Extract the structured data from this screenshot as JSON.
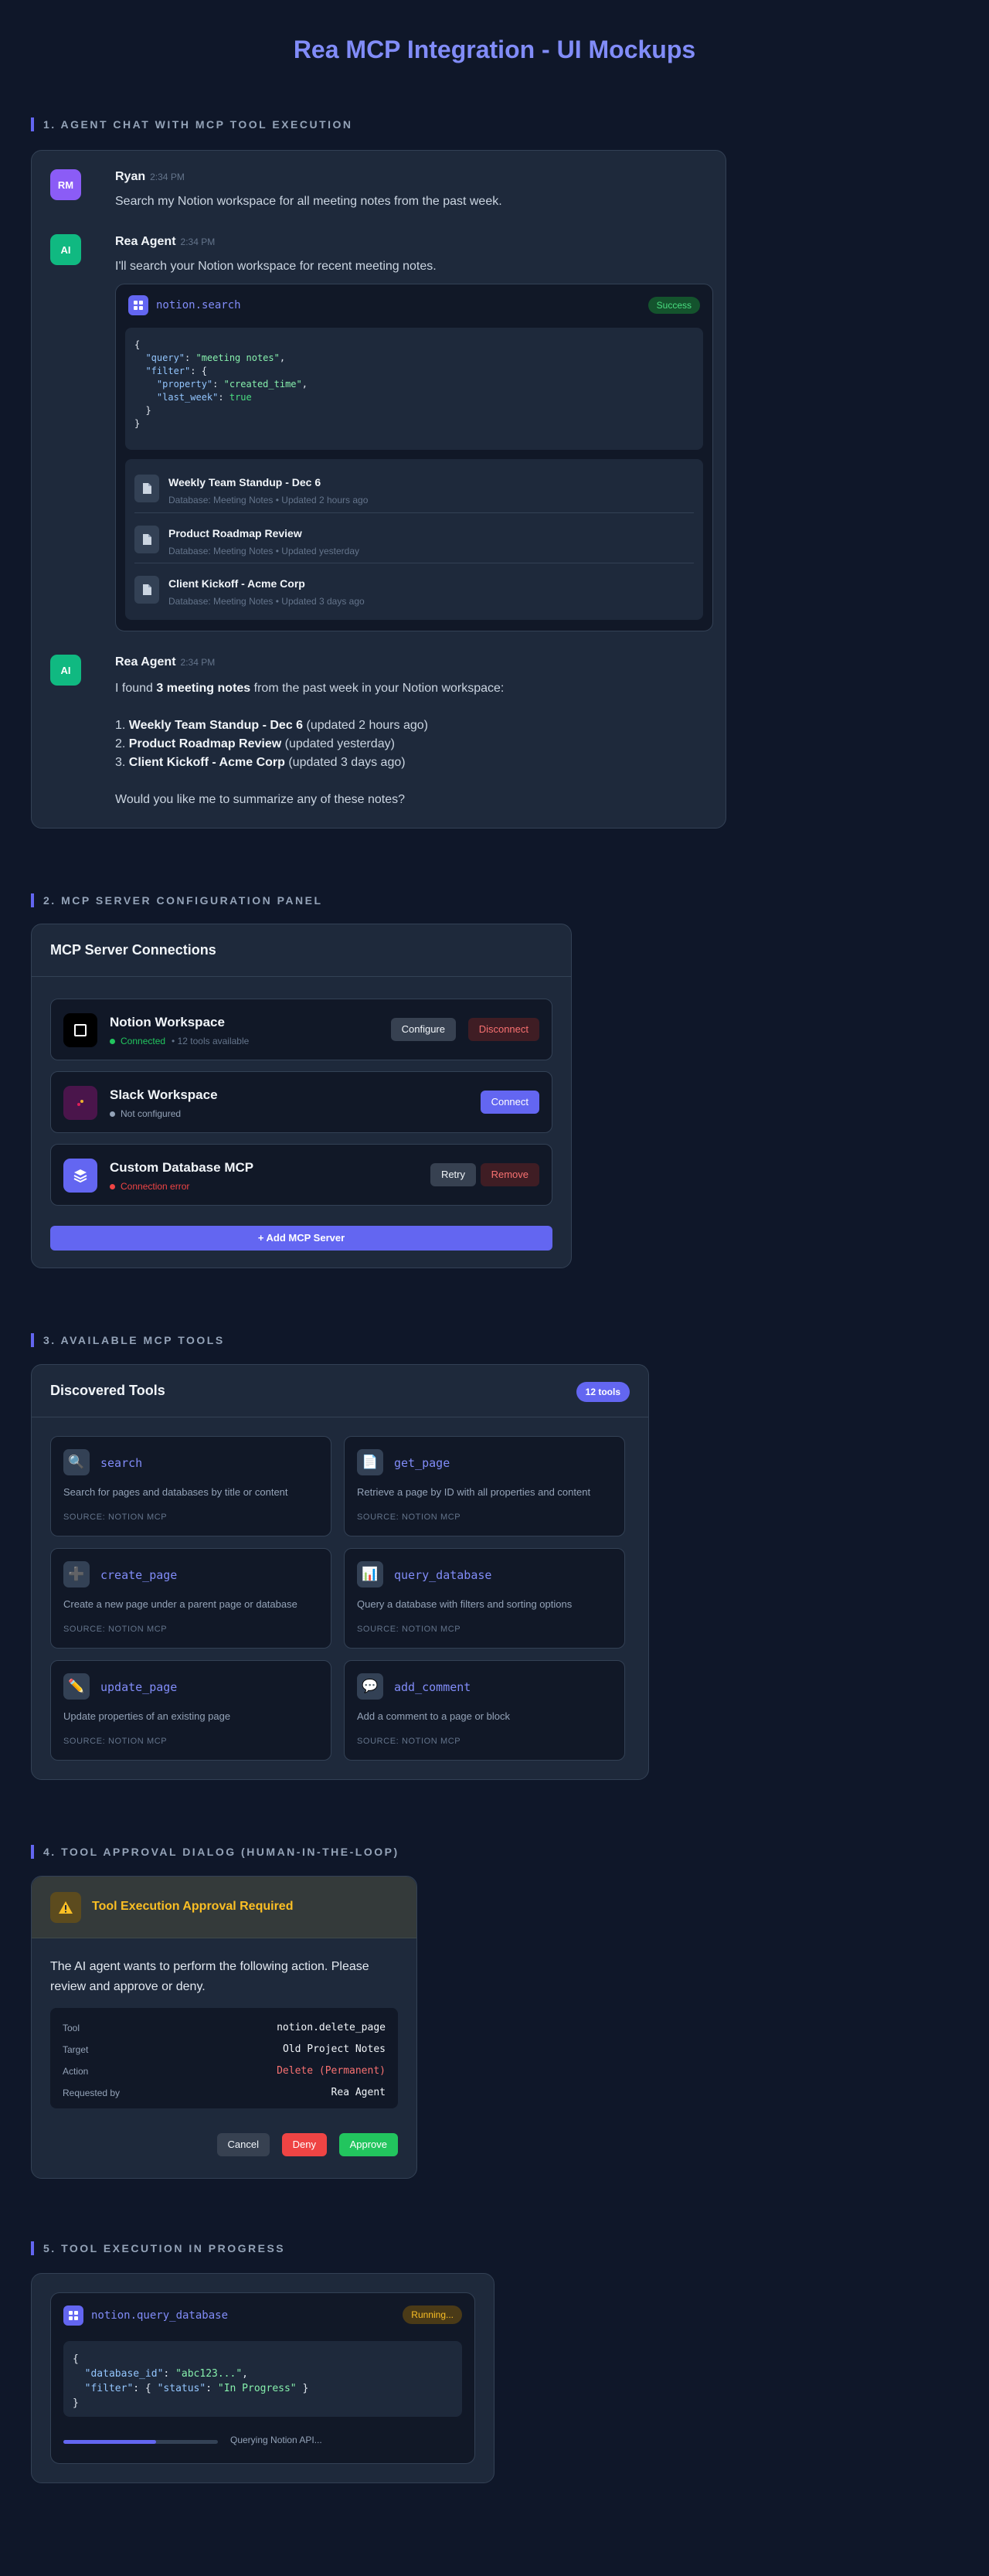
{
  "page_title": "Rea MCP Integration - UI Mockups",
  "colors": {
    "background": "#0f1729",
    "accent": "#6366f1",
    "accent_text": "#818cf8",
    "success": "#22c55e",
    "danger": "#ef4444",
    "warning": "#fbbf24"
  },
  "sections": {
    "s1": "1. AGENT CHAT WITH MCP TOOL EXECUTION",
    "s2": "2. MCP SERVER CONFIGURATION PANEL",
    "s3": "3. AVAILABLE MCP TOOLS",
    "s4": "4. TOOL APPROVAL DIALOG (HUMAN-IN-THE-LOOP)",
    "s5": "5. TOOL EXECUTION IN PROGRESS"
  },
  "chat": {
    "user": {
      "avatar": "RM",
      "name": "Ryan",
      "time": "2:34 PM",
      "text": "Search my Notion workspace for all meeting notes from the past week."
    },
    "agent1": {
      "avatar": "AI",
      "name": "Rea Agent",
      "time": "2:34 PM",
      "text": "I'll search your Notion workspace for recent meeting notes."
    },
    "tool_call": {
      "icon": "grid-icon",
      "name": "notion.search",
      "status": "Success",
      "code": {
        "l1": "{",
        "query_key": "\"query\"",
        "query_val": "\"meeting notes\"",
        "filter_key": "\"filter\"",
        "property_key": "\"property\"",
        "property_val": "\"created_time\"",
        "last_week_key": "\"last_week\"",
        "last_week_val": "true",
        "l_close_inner": "}",
        "l_close": "}"
      },
      "results": [
        {
          "title": "Weekly Team Standup - Dec 6",
          "meta": "Database: Meeting Notes • Updated 2 hours ago"
        },
        {
          "title": "Product Roadmap Review",
          "meta": "Database: Meeting Notes • Updated yesterday"
        },
        {
          "title": "Client Kickoff - Acme Corp",
          "meta": "Database: Meeting Notes • Updated 3 days ago"
        }
      ]
    },
    "agent2": {
      "avatar": "AI",
      "name": "Rea Agent",
      "time": "2:34 PM",
      "intro_a": "I found",
      "intro_b": "3 meeting notes",
      "intro_c": "from the past week in your Notion workspace:",
      "items": [
        {
          "num": "1.",
          "title": "Weekly Team Standup - Dec 6",
          "note": "(updated 2 hours ago)"
        },
        {
          "num": "2.",
          "title": "Product Roadmap Review",
          "note": "(updated yesterday)"
        },
        {
          "num": "3.",
          "title": "Client Kickoff - Acme Corp",
          "note": "(updated 3 days ago)"
        }
      ],
      "question": "Would you like me to summarize any of these notes?"
    }
  },
  "config": {
    "title": "MCP Server Connections",
    "servers": [
      {
        "name": "Notion Workspace",
        "status": "Connected",
        "extra": "• 12 tools available",
        "status_color": "#22c55e",
        "icon": "notion-icon",
        "buttons": [
          "Configure",
          "Disconnect"
        ]
      },
      {
        "name": "Slack Workspace",
        "status": "Not configured",
        "status_color": "#94a3b8",
        "icon": "slack-icon",
        "buttons": [
          "Connect"
        ]
      },
      {
        "name": "Custom Database MCP",
        "status": "Connection error",
        "status_color": "#ef4444",
        "icon": "layers-icon",
        "buttons": [
          "Retry",
          "Remove"
        ]
      }
    ],
    "add_button": "+ Add MCP Server"
  },
  "tools": {
    "title": "Discovered Tools",
    "count": "12 tools",
    "items": [
      {
        "icon": "🔍",
        "icon_name": "magnifier-icon",
        "name": "search",
        "desc": "Search for pages and databases by title or content",
        "source": "SOURCE: NOTION MCP"
      },
      {
        "icon": "📄",
        "icon_name": "page-icon",
        "name": "get_page",
        "desc": "Retrieve a page by ID with all properties and content",
        "source": "SOURCE: NOTION MCP"
      },
      {
        "icon": "➕",
        "icon_name": "plus-icon",
        "name": "create_page",
        "desc": "Create a new page under a parent page or database",
        "source": "SOURCE: NOTION MCP"
      },
      {
        "icon": "📊",
        "icon_name": "bar-chart-icon",
        "name": "query_database",
        "desc": "Query a database with filters and sorting options",
        "source": "SOURCE: NOTION MCP"
      },
      {
        "icon": "✏️",
        "icon_name": "pencil-icon",
        "name": "update_page",
        "desc": "Update properties of an existing page",
        "source": "SOURCE: NOTION MCP"
      },
      {
        "icon": "💬",
        "icon_name": "speech-bubble-icon",
        "name": "add_comment",
        "desc": "Add a comment to a page or block",
        "source": "SOURCE: NOTION MCP"
      }
    ]
  },
  "approval": {
    "title": "Tool Execution Approval Required",
    "body": "The AI agent wants to perform the following action. Please review and approve or deny.",
    "rows": [
      {
        "label": "Tool",
        "value": "notion.delete_page"
      },
      {
        "label": "Target",
        "value": "Old Project Notes"
      },
      {
        "label": "Action",
        "value": "Delete (Permanent)"
      },
      {
        "label": "Requested by",
        "value": "Rea Agent"
      }
    ],
    "cancel": "Cancel",
    "deny": "Deny",
    "approve": "Approve"
  },
  "running": {
    "name": "notion.query_database",
    "status": "Running...",
    "code": {
      "open": "{",
      "db_key": "\"database_id\"",
      "db_val": "\"abc123...\"",
      "filter_key": "\"filter\"",
      "status_key": "\"status\"",
      "status_val": "\"In Progress\"",
      "close": "}"
    },
    "progress": 0.6,
    "progress_text": "Querying Notion API..."
  }
}
